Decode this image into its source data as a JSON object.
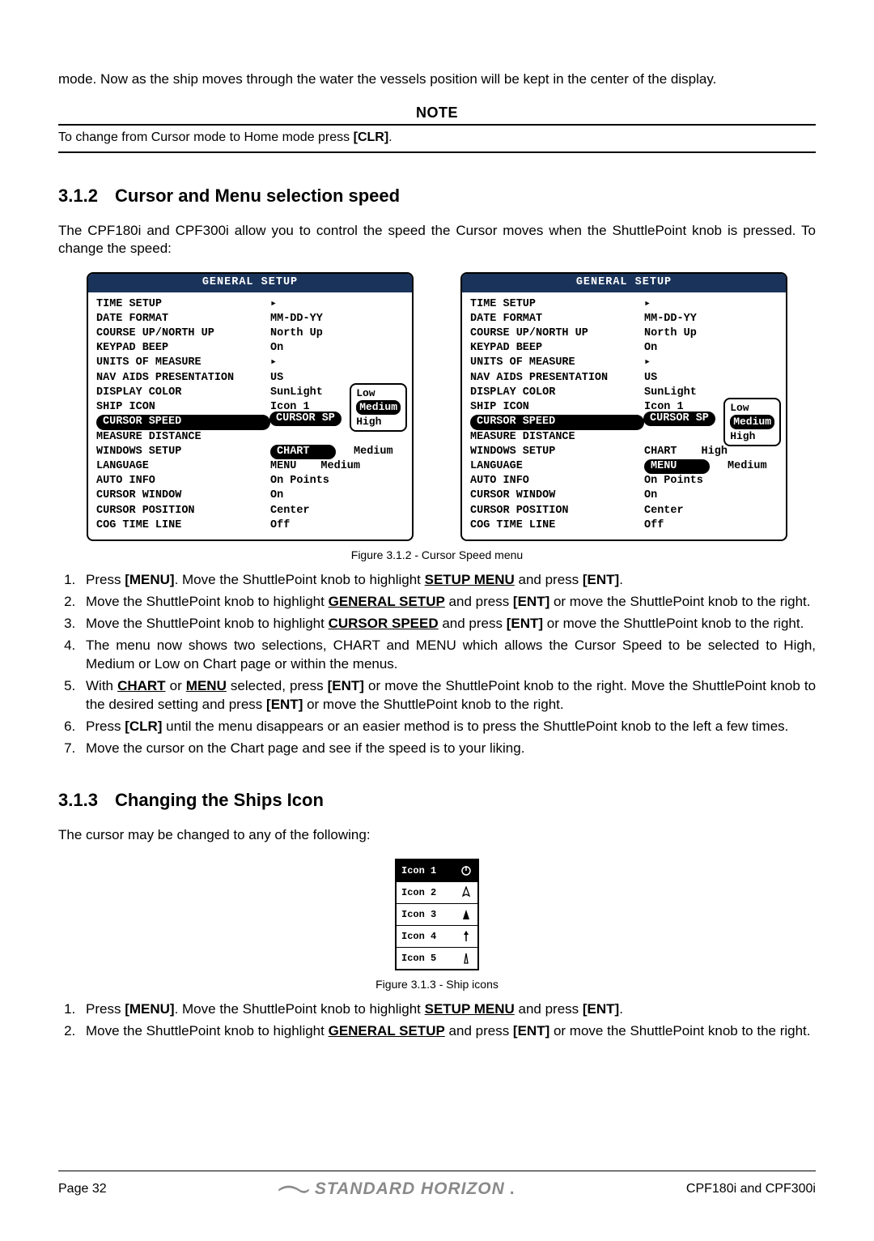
{
  "intro": "mode. Now as the ship moves through the water the vessels position will be kept in the center of the display.",
  "note": {
    "title": "NOTE",
    "body_1": "To change from Cursor mode to Home mode press ",
    "body_key": "[CLR]",
    "body_2": "."
  },
  "sec312": {
    "num": "3.1.2",
    "title": "Cursor and Menu selection speed",
    "lead": "The CPF180i and CPF300i allow you to control the speed the Cursor moves when the ShuttlePoint knob is pressed. To change the speed:",
    "figure_caption": "Figure 3.1.2 - Cursor Speed menu"
  },
  "menu": {
    "title": "GENERAL SETUP",
    "rows": [
      {
        "lbl": "TIME SETUP",
        "val": "▸"
      },
      {
        "lbl": "DATE FORMAT",
        "val": "MM-DD-YY"
      },
      {
        "lbl": "COURSE UP/NORTH UP",
        "val": "North Up"
      },
      {
        "lbl": "KEYPAD BEEP",
        "val": "On"
      },
      {
        "lbl": "UNITS OF MEASURE",
        "val": "▸"
      },
      {
        "lbl": "NAV AIDS PRESENTATION",
        "val": "US"
      },
      {
        "lbl": "DISPLAY COLOR",
        "val": "SunLight"
      },
      {
        "lbl": "SHIP ICON",
        "val": "Icon 1"
      },
      {
        "lbl": "CURSOR SPEED",
        "val": "CURSOR SP",
        "highlight": true
      },
      {
        "lbl": "MEASURE DISTANCE",
        "val": ""
      },
      {
        "lbl": "WINDOWS SETUP",
        "val": "",
        "sublabel": "CHART",
        "subval": "Medium",
        "pill": true
      },
      {
        "lbl": "LANGUAGE",
        "val": "",
        "sublabel": "MENU",
        "subval": "Medium",
        "pill": true
      },
      {
        "lbl": "AUTO INFO",
        "val": "On Points"
      },
      {
        "lbl": "CURSOR WINDOW",
        "val": "On"
      },
      {
        "lbl": "CURSOR POSITION",
        "val": "Center"
      },
      {
        "lbl": "COG TIME LINE",
        "val": "Off"
      }
    ],
    "popup_a": {
      "opts": [
        "Low",
        "Medium",
        "High"
      ],
      "sel": 1
    },
    "popup_b": {
      "opts": [
        "Low",
        "Medium",
        "High"
      ],
      "sel": 1,
      "sublabel_b": "MENU",
      "subval_b": "Medium"
    }
  },
  "steps312": [
    {
      "parts": [
        "Press ",
        "<b>[MENU]</b>",
        ". Move the ShuttlePoint knob to highlight ",
        "<b><u>SETUP MENU</u></b>",
        " and press ",
        "<b>[ENT]</b>",
        "."
      ]
    },
    {
      "parts": [
        "Move the ShuttlePoint knob to highlight ",
        "<b><u>GENERAL SETUP</u></b>",
        " and press ",
        "<b>[ENT]</b>",
        " or move the ShuttlePoint knob to the right."
      ]
    },
    {
      "parts": [
        "Move the ShuttlePoint knob to highlight ",
        "<b><u>CURSOR SPEED</u></b>",
        " and press ",
        "<b>[ENT]</b>",
        " or move the ShuttlePoint knob to the right."
      ]
    },
    {
      "parts": [
        "The menu now shows two selections, CHART and MENU which allows the Cursor Speed to be selected to High, Medium or Low on Chart page or within the menus."
      ]
    },
    {
      "parts": [
        "With ",
        "<b><u>CHART</u></b>",
        " or ",
        "<b><u>MENU</u></b>",
        " selected, press ",
        "<b>[ENT]</b>",
        " or move the ShuttlePoint knob to the right. Move the ShuttlePoint knob to the desired setting and press ",
        "<b>[ENT]</b>",
        " or move the ShuttlePoint knob to the right."
      ]
    },
    {
      "parts": [
        "Press ",
        "<b>[CLR]</b>",
        " until the menu disappears or an easier method is to press the ShuttlePoint knob to the left a few times."
      ]
    },
    {
      "parts": [
        "Move the cursor on the Chart page and see if the speed is to your liking."
      ]
    }
  ],
  "sec313": {
    "num": "3.1.3",
    "title": "Changing the Ships Icon",
    "lead": "The cursor may be changed to any of the following:",
    "figure_caption": "Figure 3.1.3 - Ship icons"
  },
  "icons": [
    {
      "lbl": "Icon 1",
      "sel": true
    },
    {
      "lbl": "Icon 2"
    },
    {
      "lbl": "Icon 3"
    },
    {
      "lbl": "Icon 4"
    },
    {
      "lbl": "Icon 5"
    }
  ],
  "steps313": [
    {
      "parts": [
        "Press ",
        "<b>[MENU]</b>",
        ". Move the ShuttlePoint knob to highlight ",
        "<b><u>SETUP MENU</u></b>",
        " and press ",
        "<b>[ENT]</b>",
        "."
      ]
    },
    {
      "parts": [
        "Move the ShuttlePoint knob to highlight ",
        "<b><u>GENERAL SETUP</u></b>",
        " and press ",
        "<b>[ENT]</b>",
        " or move the ShuttlePoint knob to the right."
      ]
    }
  ],
  "footer": {
    "page": "Page  32",
    "brand": "STANDARD HORIZON",
    "model": "CPF180i and CPF300i"
  }
}
